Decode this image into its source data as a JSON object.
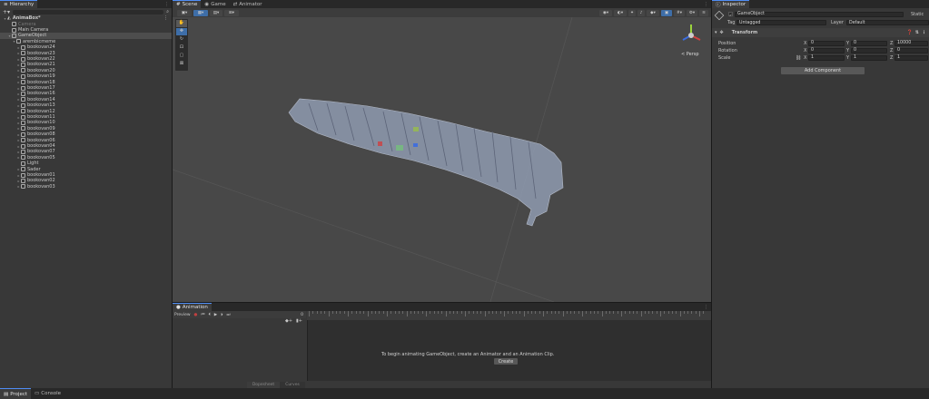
{
  "colors": {
    "accent": "#4f8df5",
    "selection": "#4d4d4d",
    "bg": "#383838"
  },
  "hierarchy": {
    "tab_label": "Hierarchy",
    "scene_name": "AnimaBox*",
    "items": [
      {
        "label": "Camera",
        "depth": 1,
        "arrow": ""
      },
      {
        "label": "Main Camera",
        "depth": 1,
        "arrow": ""
      },
      {
        "label": "GameObject",
        "depth": 1,
        "arrow": "▾",
        "selected": true
      },
      {
        "label": "arembicmeme",
        "depth": 2,
        "arrow": "▾"
      },
      {
        "label": "bookovan24",
        "depth": 3,
        "arrow": "▸"
      },
      {
        "label": "bookovan23",
        "depth": 3,
        "arrow": "▸"
      },
      {
        "label": "bookovan22",
        "depth": 3,
        "arrow": "▸"
      },
      {
        "label": "bookovan21",
        "depth": 3,
        "arrow": "▸"
      },
      {
        "label": "bookovan20",
        "depth": 3,
        "arrow": "▸"
      },
      {
        "label": "bookovan19",
        "depth": 3,
        "arrow": "▸"
      },
      {
        "label": "bookovan18",
        "depth": 3,
        "arrow": "▸"
      },
      {
        "label": "bookovan17",
        "depth": 3,
        "arrow": "▸"
      },
      {
        "label": "bookovan16",
        "depth": 3,
        "arrow": "▸"
      },
      {
        "label": "bookovan14",
        "depth": 3,
        "arrow": "▸"
      },
      {
        "label": "bookovan13",
        "depth": 3,
        "arrow": "▸"
      },
      {
        "label": "bookovan12",
        "depth": 3,
        "arrow": "▸"
      },
      {
        "label": "bookovan11",
        "depth": 3,
        "arrow": "▸"
      },
      {
        "label": "bookovan10",
        "depth": 3,
        "arrow": "▸"
      },
      {
        "label": "bookovan09",
        "depth": 3,
        "arrow": "▸"
      },
      {
        "label": "bookovan08",
        "depth": 3,
        "arrow": "▸"
      },
      {
        "label": "bookovan06",
        "depth": 3,
        "arrow": "▸"
      },
      {
        "label": "bookovan04",
        "depth": 3,
        "arrow": "▸"
      },
      {
        "label": "bookovan07",
        "depth": 3,
        "arrow": "▸"
      },
      {
        "label": "bookovan05",
        "depth": 3,
        "arrow": "▸"
      },
      {
        "label": "Light",
        "depth": 3,
        "arrow": ""
      },
      {
        "label": "Sader",
        "depth": 3,
        "arrow": "▸"
      },
      {
        "label": "bookovan01",
        "depth": 3,
        "arrow": "▸"
      },
      {
        "label": "bookovan02",
        "depth": 3,
        "arrow": "▸"
      },
      {
        "label": "bookovan03",
        "depth": 3,
        "arrow": "▸"
      }
    ]
  },
  "scene": {
    "tabs": [
      {
        "label": "Scene",
        "icon": "#"
      },
      {
        "label": "Game",
        "icon": "◉"
      },
      {
        "label": "Animator",
        "icon": "⇄"
      }
    ],
    "persp_label": "< Persp"
  },
  "animation": {
    "tab_label": "Animation",
    "preview_label": "Preview",
    "frame_value": "0",
    "message": "To begin animating GameObject, create an Animator and an Animation Clip.",
    "create_button": "Create",
    "bottom_tabs": [
      "Dopesheet",
      "Curves"
    ]
  },
  "inspector": {
    "tab_label": "Inspector",
    "object_name": "GameObject",
    "static_label": "Static",
    "tag_label": "Tag",
    "tag_value": "Untagged",
    "layer_label": "Layer",
    "layer_value": "Default",
    "transform_label": "Transform",
    "position_label": "Position",
    "rotation_label": "Rotation",
    "scale_label": "Scale",
    "position": {
      "x": "0",
      "y": "0",
      "z": "10000"
    },
    "rotation": {
      "x": "0",
      "y": "0",
      "z": "0"
    },
    "scale": {
      "x": "1",
      "y": "1",
      "z": "1"
    },
    "axis_x": "X",
    "axis_y": "Y",
    "axis_z": "Z",
    "add_component": "Add Component"
  },
  "bottom": {
    "tabs": [
      "Project",
      "Console"
    ]
  }
}
